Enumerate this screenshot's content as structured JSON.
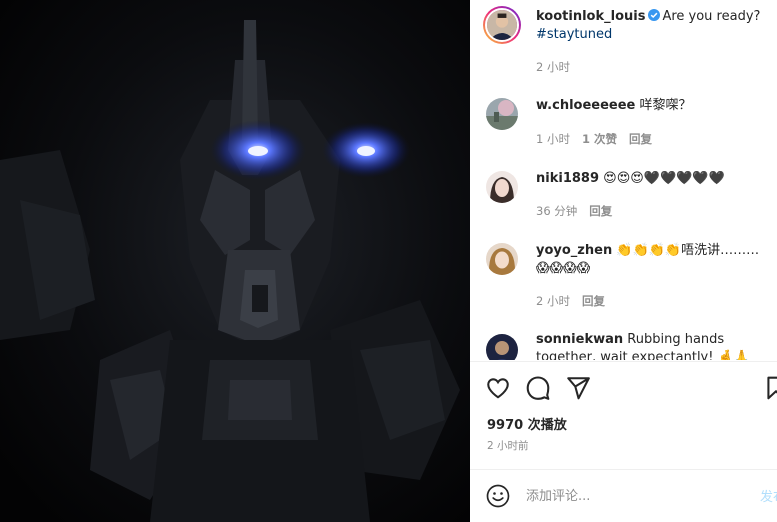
{
  "post": {
    "author": "kootinlok_louis",
    "caption": "Are you ready?",
    "hashtag": "#staytuned",
    "time": "2 小时"
  },
  "comments": [
    {
      "username": "w.chloeeeeee",
      "text": "咩黎㗎？",
      "time": "1 小时",
      "likes": "1 次赞",
      "reply": "回复"
    },
    {
      "username": "niki1889",
      "text": "😍😍😍🖤🖤🖤🖤🖤",
      "time": "36 分钟",
      "reply": "回复"
    },
    {
      "username": "yoyo_zhen",
      "text": "👏👏👏👏唔洗讲………😱😱😱😱",
      "time": "2 小时",
      "reply": "回复"
    },
    {
      "username": "sonniekwan",
      "text": "Rubbing hands together, wait expectantly! 🤞🙏😍"
    }
  ],
  "actions": {
    "like_icon": "heart-outline-icon",
    "comment_icon": "comment-bubble-icon",
    "share_icon": "paper-plane-icon",
    "save_icon": "bookmark-icon"
  },
  "stats": {
    "views": "9970 次播放",
    "posted": "2 小时前"
  },
  "composer": {
    "emoji_icon": "smiley-icon",
    "placeholder": "添加评论...",
    "post_label": "发布"
  },
  "colors": {
    "link": "#00376b",
    "verified": "#3897f0",
    "muted": "#8e8e8e",
    "post_disabled": "#b2dffc",
    "eye_glow": "#3a5cff"
  }
}
